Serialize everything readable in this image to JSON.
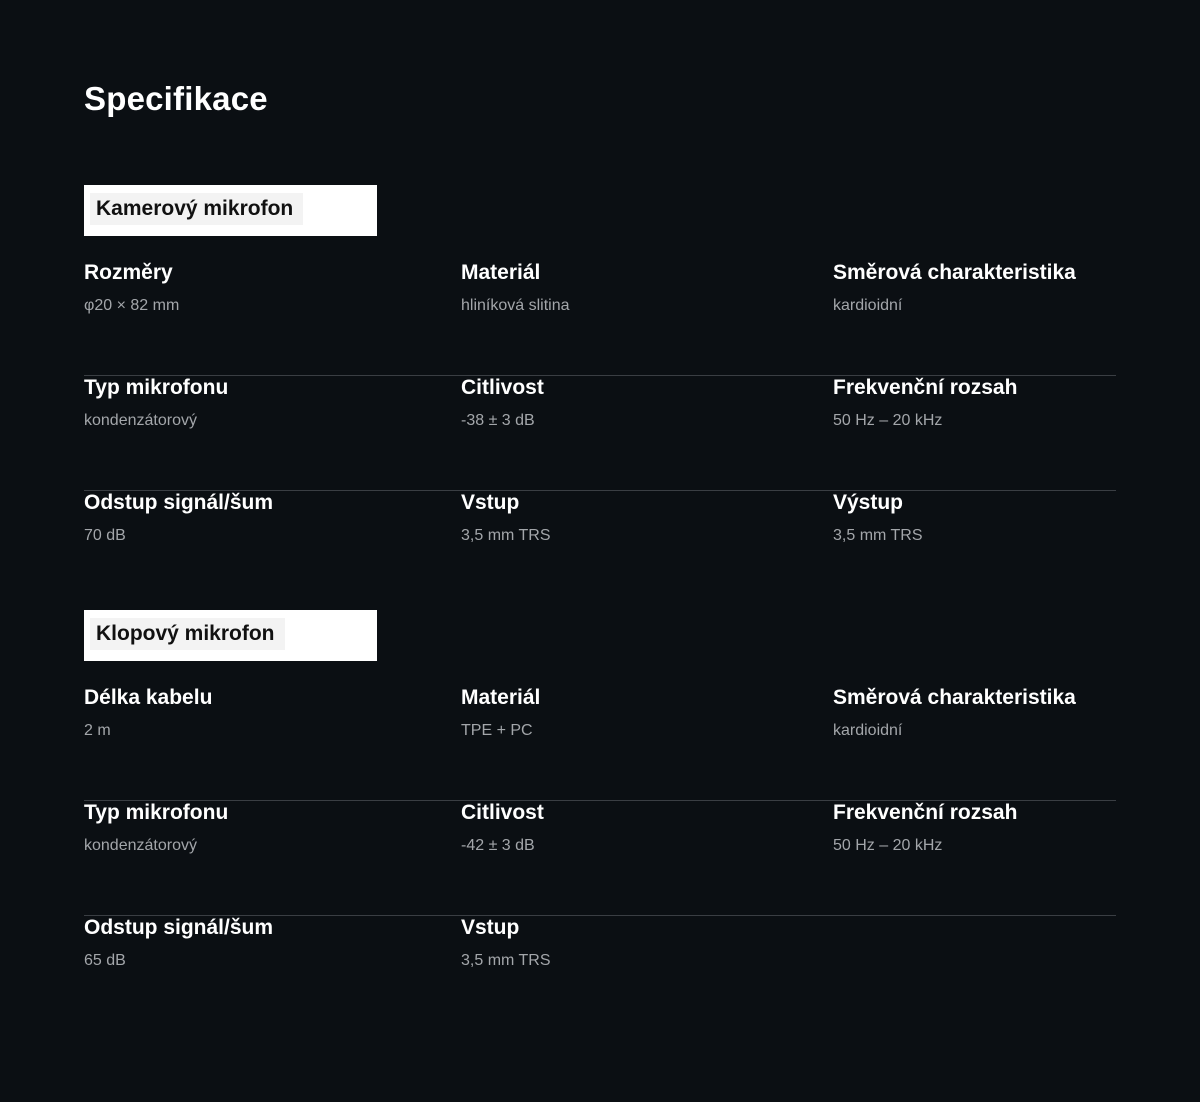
{
  "page_title": "Specifikace",
  "sections": [
    {
      "title": "Kamerový mikrofon",
      "rows": [
        [
          {
            "label": "Rozměry",
            "value": "φ20 × 82 mm"
          },
          {
            "label": "Materiál",
            "value": "hliníková slitina"
          },
          {
            "label": "Směrová charakteristika",
            "value": "kardioidní"
          }
        ],
        [
          {
            "label": "Typ mikrofonu",
            "value": "kondenzátorový"
          },
          {
            "label": "Citlivost",
            "value": "-38 ± 3 dB"
          },
          {
            "label": "Frekvenční rozsah",
            "value": "50 Hz – 20 kHz"
          }
        ],
        [
          {
            "label": "Odstup signál/šum",
            "value": "70 dB"
          },
          {
            "label": "Vstup",
            "value": "3,5 mm TRS"
          },
          {
            "label": "Výstup",
            "value": "3,5 mm TRS"
          }
        ]
      ]
    },
    {
      "title": "Klopový mikrofon",
      "rows": [
        [
          {
            "label": "Délka kabelu",
            "value": "2 m"
          },
          {
            "label": "Materiál",
            "value": "TPE + PC"
          },
          {
            "label": "Směrová charakteristika",
            "value": "kardioidní"
          }
        ],
        [
          {
            "label": "Typ mikrofonu",
            "value": "kondenzátorový"
          },
          {
            "label": "Citlivost",
            "value": "-42 ± 3 dB"
          },
          {
            "label": "Frekvenční rozsah",
            "value": "50 Hz – 20 kHz"
          }
        ],
        [
          {
            "label": "Odstup signál/šum",
            "value": "65 dB"
          },
          {
            "label": "Vstup",
            "value": "3,5 mm TRS"
          }
        ]
      ]
    }
  ]
}
